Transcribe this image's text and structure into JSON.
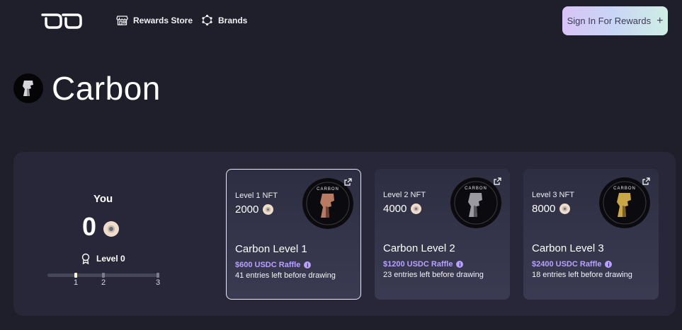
{
  "header": {
    "logo": "DO-logo",
    "nav": [
      {
        "label": "Rewards Store",
        "icon": "storefront-icon"
      },
      {
        "label": "Brands",
        "icon": "brands-icon"
      }
    ],
    "signin_label": "Sign In For Rewards",
    "signin_icon": "plus-icon"
  },
  "title": "Carbon",
  "user": {
    "label": "You",
    "points": "0",
    "level_label": "Level 0",
    "progress_ticks": [
      "1",
      "2",
      "3"
    ],
    "current_tick": 1
  },
  "cards": [
    {
      "level_nft": "Level 1 NFT",
      "price": "2000",
      "title": "Carbon Level 1",
      "raffle": "$600 USDC Raffle",
      "entries": "41 entries left before drawing",
      "tone": "#b77a63"
    },
    {
      "level_nft": "Level 2 NFT",
      "price": "4000",
      "title": "Carbon Level 2",
      "raffle": "$1200 USDC Raffle",
      "entries": "23 entries left before drawing",
      "tone": "#9a9aa0"
    },
    {
      "level_nft": "Level 3 NFT",
      "price": "8000",
      "title": "Carbon Level 3",
      "raffle": "$2400 USDC Raffle",
      "entries": "18 entries left before drawing",
      "tone": "#c9a648"
    }
  ],
  "colors": {
    "background": "#1f1e2b",
    "panel": "#28273a",
    "accent_purple": "#b9a1ff"
  }
}
